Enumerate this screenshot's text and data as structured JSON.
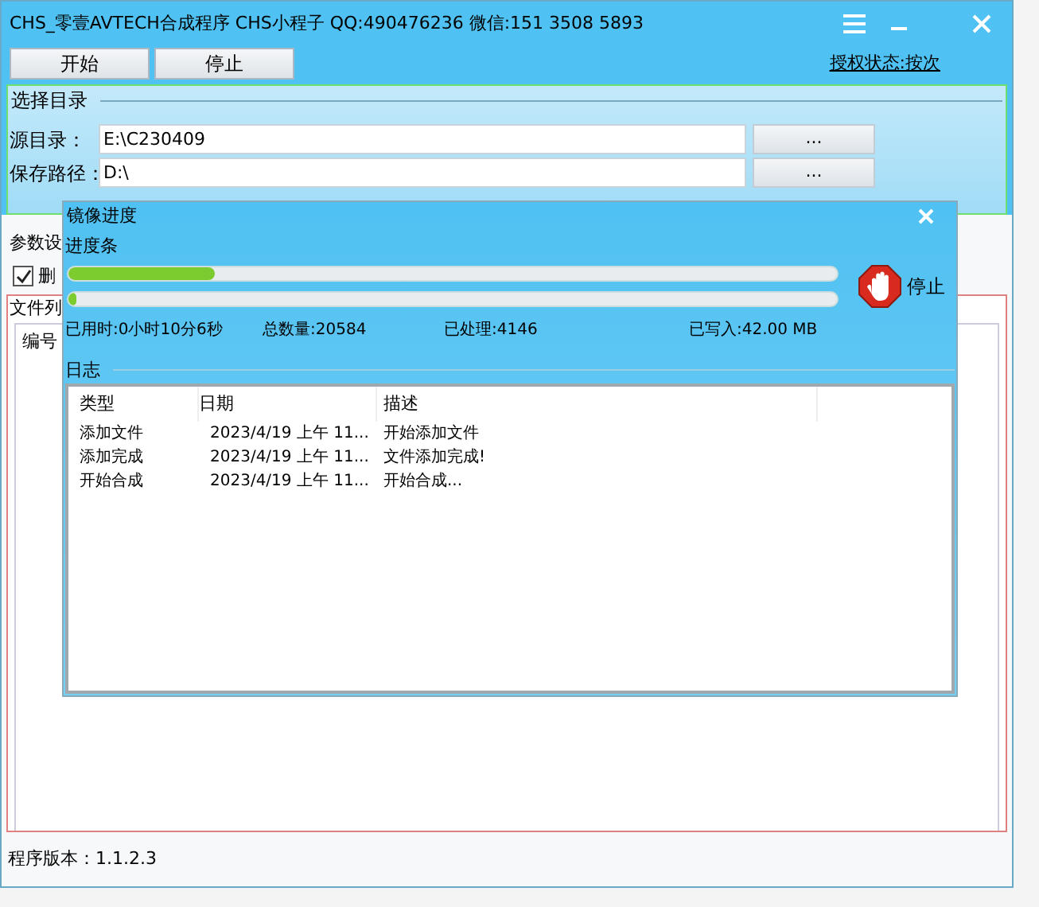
{
  "window": {
    "title": "CHS_零壹AVTECH合成程序 CHS小程子 QQ:490476236 微信:151 3508 5893"
  },
  "toolbar": {
    "buttons": [
      "开始",
      "停止"
    ],
    "auth_link": "授权状态:按次"
  },
  "directory_group": {
    "title": "选择目录",
    "fields": [
      {
        "label": "源目录：",
        "value": "E:\\C230409",
        "browse": "..."
      },
      {
        "label": "保存路径：",
        "value": "D:\\",
        "browse": "..."
      }
    ]
  },
  "params": {
    "title": "参数设",
    "checkbox": {
      "label": "删",
      "checked": true
    }
  },
  "file_list": {
    "title": "文件列",
    "columns": [
      "编号"
    ]
  },
  "status_bar": "程序版本：1.1.2.3",
  "dialog": {
    "title": "镜像进度",
    "progress_title": "进度条",
    "bars": [
      {
        "level": 0.19
      },
      {
        "level": 0.01
      }
    ],
    "stop_button": "停止",
    "stats": [
      "已用时:0小时10分6秒",
      "总数量:20584",
      "已处理:4146",
      "已写入:42.00 MB"
    ],
    "log": {
      "title": "日志",
      "columns": [
        "类型",
        "日期",
        "描述"
      ],
      "rows": [
        [
          "添加文件",
          "2023/4/19 上午 11...",
          "开始添加文件"
        ],
        [
          "添加完成",
          "2023/4/19 上午 11...",
          "文件添加完成!"
        ],
        [
          "开始合成",
          "2023/4/19 上午 11...",
          "开始合成..."
        ]
      ]
    }
  }
}
